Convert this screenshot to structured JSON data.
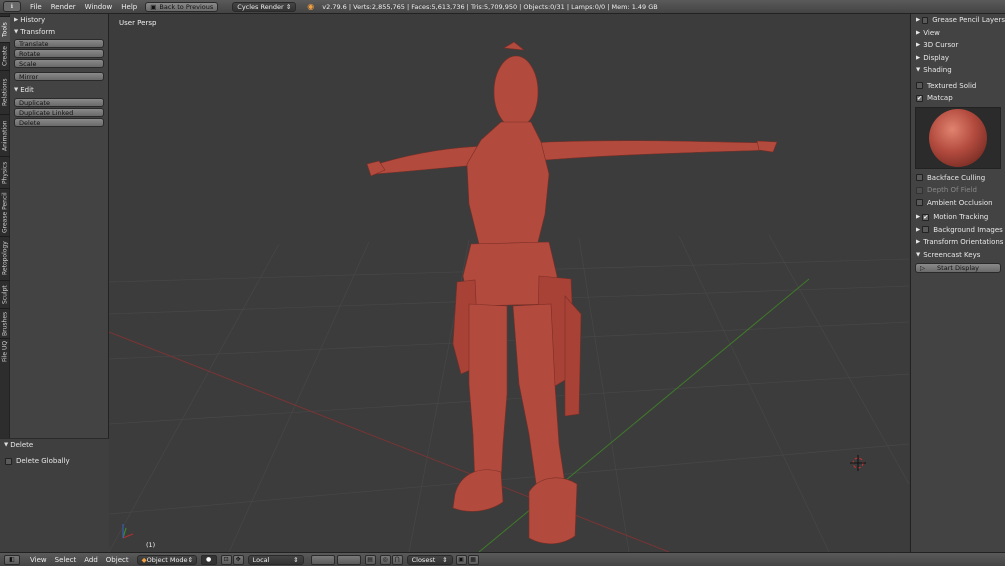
{
  "top": {
    "menus": [
      "File",
      "Render",
      "Window",
      "Help"
    ],
    "back_label": "Back to Previous",
    "engine": "Cycles Render",
    "stats": "v2.79.6 | Verts:2,855,765 | Faces:5,613,736 | Tris:5,709,950 | Objects:0/31 | Lamps:0/0 | Mem: 1.49 GB"
  },
  "tool_tabs": [
    "Tools",
    "Create",
    "Relations",
    "Animation",
    "Physics",
    "Grease Pencil",
    "Retopology",
    "Sculpt",
    "Brushes",
    "File UQ"
  ],
  "toolshelf": {
    "history": "History",
    "transform": "Transform",
    "transform_buttons": [
      "Translate",
      "Rotate",
      "Scale"
    ],
    "mirror": "Mirror",
    "edit": "Edit",
    "edit_buttons": [
      "Duplicate",
      "Duplicate Linked",
      "Delete"
    ],
    "operator_title": "Delete",
    "operator_option": "Delete Globally"
  },
  "viewport": {
    "persp": "User Persp",
    "frame": "(1)"
  },
  "props": {
    "grease_pencil": "Grease Pencil Layers",
    "view": "View",
    "cursor": "3D Cursor",
    "display": "Display",
    "shading": "Shading",
    "textured_solid": "Textured Solid",
    "matcap": "Matcap",
    "backface": "Backface Culling",
    "dof": "Depth Of Field",
    "ao": "Ambient Occlusion",
    "motion_tracking": "Motion Tracking",
    "background_images": "Background Images",
    "transform_orientations": "Transform Orientations",
    "screencast": "Screencast Keys",
    "start_display": "Start Display"
  },
  "bottom": {
    "menus": [
      "View",
      "Select",
      "Add",
      "Object"
    ],
    "mode": "Object Mode",
    "pivot": "Local",
    "snap": "Closest"
  },
  "colors": {
    "model": "#b24a3e",
    "x_axis": "#7a3434",
    "y_axis": "#3f7a2a"
  }
}
